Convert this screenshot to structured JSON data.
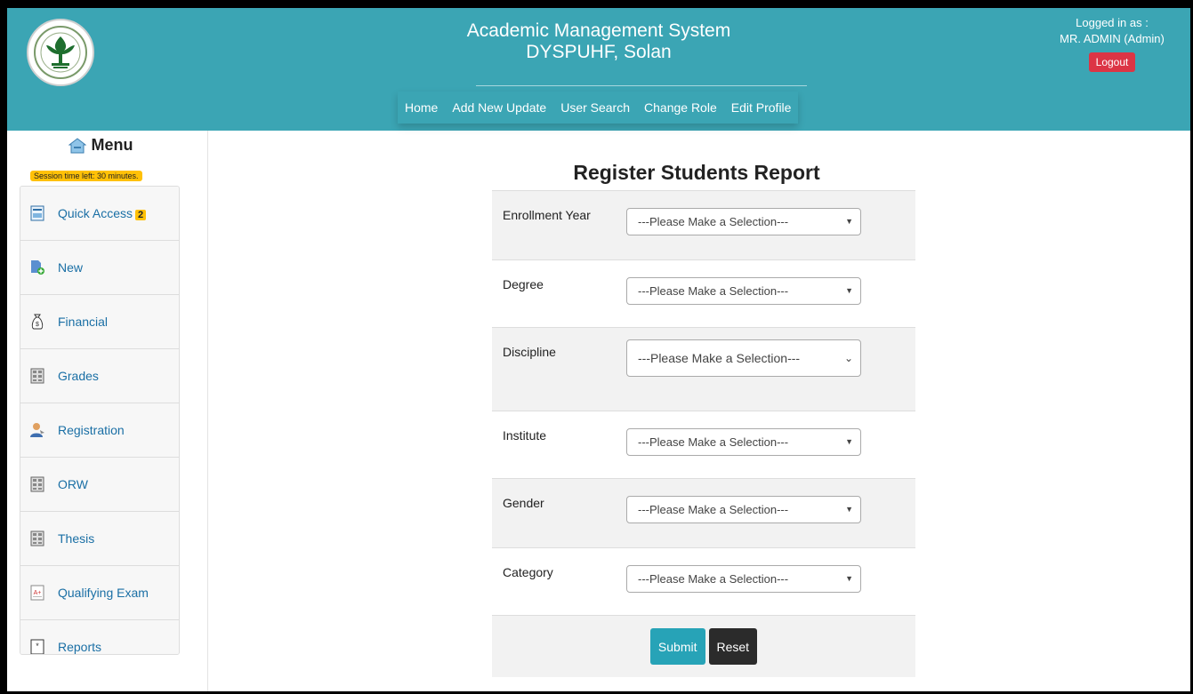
{
  "header": {
    "title_line1": "Academic Management System",
    "title_line2": "DYSPUHF, Solan",
    "nav": [
      "Home",
      "Add New Update",
      "User Search",
      "Change Role",
      "Edit Profile"
    ],
    "logged_in_label": "Logged in as :",
    "user": "MR. ADMIN (Admin)",
    "logout_label": "Logout"
  },
  "sidebar": {
    "title": "Menu",
    "session": "Session time left: 30 minutes.",
    "items": [
      {
        "label": "Quick Access",
        "badge": "2",
        "icon": "quick-access-icon"
      },
      {
        "label": "New",
        "icon": "new-document-icon"
      },
      {
        "label": "Financial",
        "icon": "money-bag-icon"
      },
      {
        "label": "Grades",
        "icon": "grid-icon"
      },
      {
        "label": "Registration",
        "icon": "user-icon"
      },
      {
        "label": "ORW",
        "icon": "grid-icon"
      },
      {
        "label": "Thesis",
        "icon": "grid-icon"
      },
      {
        "label": "Qualifying Exam",
        "icon": "exam-paper-icon"
      },
      {
        "label": "Reports",
        "icon": "report-icon"
      }
    ]
  },
  "main": {
    "title": "Register Students Report",
    "fields": [
      {
        "label": "Enrollment Year",
        "value": "---Please Make a Selection---"
      },
      {
        "label": "Degree",
        "value": "---Please Make a Selection---"
      },
      {
        "label": "Discipline",
        "value": "---Please Make a Selection---"
      },
      {
        "label": "Institute",
        "value": "---Please Make a Selection---"
      },
      {
        "label": "Gender",
        "value": "---Please Make a Selection---"
      },
      {
        "label": "Category",
        "value": "---Please Make a Selection---"
      }
    ],
    "submit_label": "Submit",
    "reset_label": "Reset"
  },
  "colors": {
    "header": "#3ba5b4",
    "logout": "#dc3545",
    "badge": "#ffc107",
    "submit": "#27a3b7",
    "reset": "#2b2b2b"
  }
}
